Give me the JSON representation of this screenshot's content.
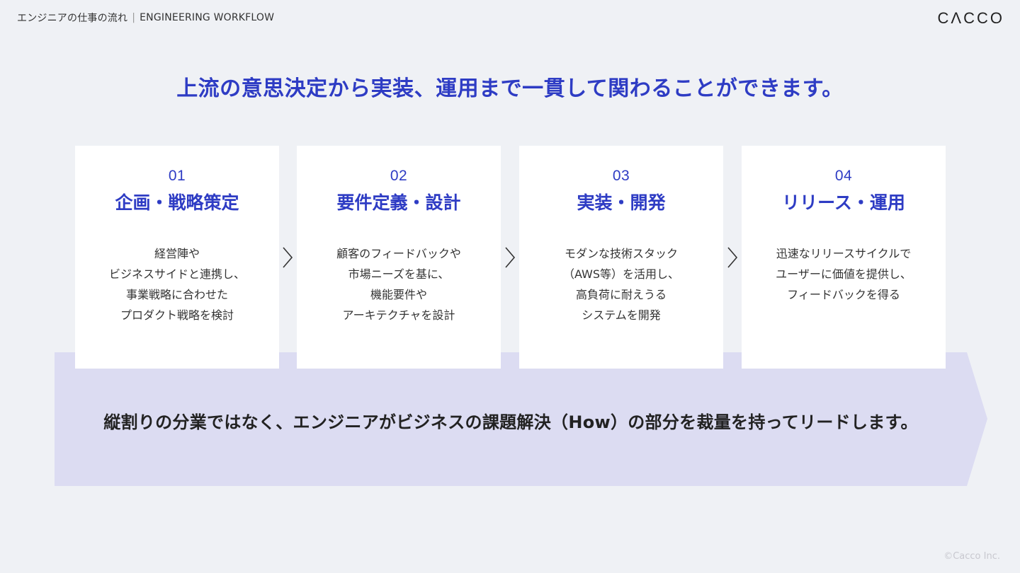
{
  "header": {
    "section_jp": "エンジニアの仕事の流れ",
    "separator": "|",
    "section_en": "ENGINEERING WORKFLOW",
    "logo": "CΛCCO"
  },
  "headline": "上流の意思決定から実装、運用まで一貫して関わることができます。",
  "steps": [
    {
      "num": "01",
      "title": "企画・戦略策定",
      "desc": [
        "経営陣や",
        "ビジネスサイドと連携し、",
        "事業戦略に合わせた",
        "プロダクト戦略を検討"
      ]
    },
    {
      "num": "02",
      "title": "要件定義・設計",
      "desc": [
        "顧客のフィードバックや",
        "市場ニーズを基に、",
        "機能要件や",
        "アーキテクチャを設計"
      ]
    },
    {
      "num": "03",
      "title": "実装・開発",
      "desc": [
        "モダンな技術スタック",
        "（AWS等）を活用し、",
        "高負荷に耐えうる",
        "システムを開発"
      ]
    },
    {
      "num": "04",
      "title": "リリース・運用",
      "desc": [
        "迅速なリリースサイクルで",
        "ユーザーに価値を提供し、",
        "フィードバックを得る"
      ]
    }
  ],
  "band_text": "縦割りの分業ではなく、エンジニアがビジネスの課題解決（How）の部分を裁量を持ってリードします。",
  "copyright": "©Cacco Inc."
}
